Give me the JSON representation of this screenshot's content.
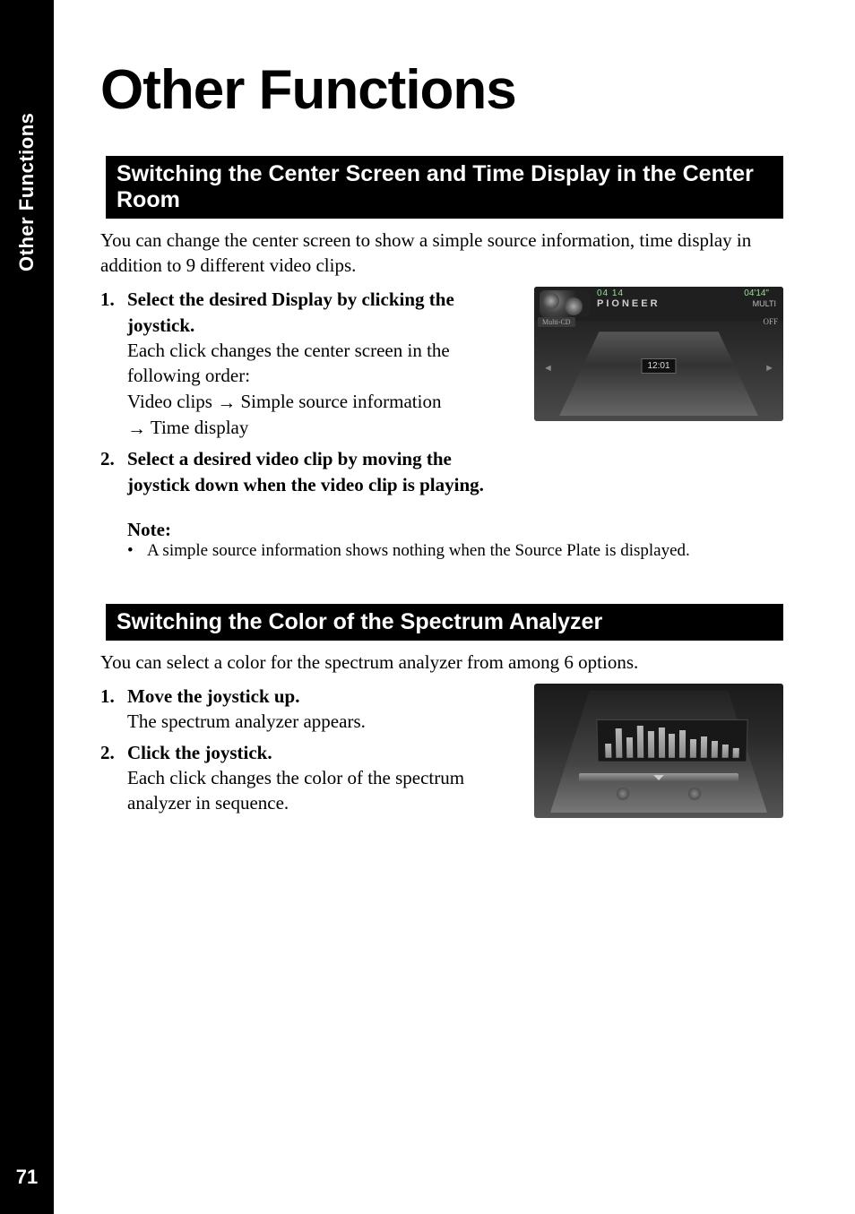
{
  "tab_label": "Other Functions",
  "page_number": "71",
  "chapter_title": "Other Functions",
  "section1": {
    "heading": "Switching the Center Screen and Time Display in the Center Room",
    "intro": "You can change the center screen to show a simple source information, time display in addition to 9 different video clips.",
    "steps": [
      {
        "num": "1.",
        "head": "Select the desired Display by clicking the joystick.",
        "body": "Each click changes the center screen in the following order:",
        "flow_pre": "Video clips",
        "flow_mid": "Simple source information",
        "flow_post": "Time display"
      },
      {
        "num": "2.",
        "head": "Select a desired video clip by moving the joystick down when the video clip is playing."
      }
    ],
    "note_label": "Note:",
    "note_bullet": "A simple source information shows nothing when the Source Plate is displayed."
  },
  "fig1": {
    "track": "04   14",
    "brand": "PIONEER",
    "time": "04'14\"",
    "multi": "MULTI",
    "source": "Multi-CD",
    "off": "OFF",
    "clock": "12:01",
    "left_arrow": "◄",
    "right_arrow": "►"
  },
  "section2": {
    "heading": "Switching the Color of the Spectrum Analyzer",
    "intro": "You can select a color for the spectrum analyzer from among 6 options.",
    "steps": [
      {
        "num": "1.",
        "head": "Move the joystick up.",
        "body": "The spectrum analyzer appears."
      },
      {
        "num": "2.",
        "head": "Click the joystick.",
        "body": "Each click changes the color of the spectrum analyzer in sequence."
      }
    ]
  },
  "arrow_glyph": "→"
}
